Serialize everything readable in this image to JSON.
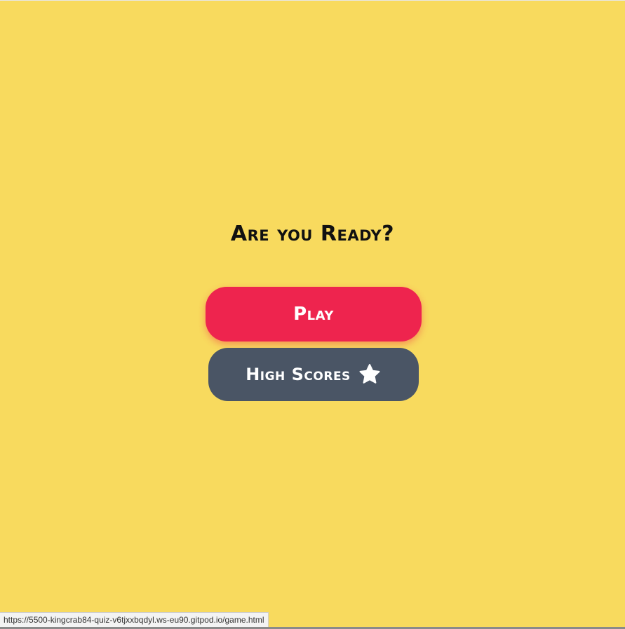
{
  "page": {
    "background_color": "#f8da5e",
    "title": "Are you Ready?"
  },
  "buttons": {
    "play": {
      "label": "Play",
      "color": "#ee244e"
    },
    "high_scores": {
      "label": "High Scores",
      "color": "#4a5565",
      "icon": "star-icon"
    }
  },
  "status_bar": {
    "url": "https://5500-kingcrab84-quiz-v6tjxxbqdyl.ws-eu90.gitpod.io/game.html"
  }
}
